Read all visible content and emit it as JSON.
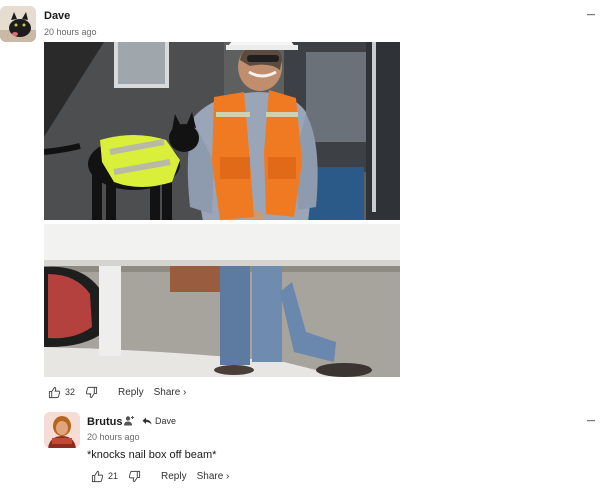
{
  "comments": [
    {
      "author": "Dave",
      "time": "20 hours ago",
      "likes": "32",
      "reply_label": "Reply",
      "share_label": "Share ›"
    },
    {
      "author": "Brutus",
      "reply_to": "Dave",
      "time": "20 hours ago",
      "text": "*knocks nail box off beam*",
      "likes": "21",
      "reply_label": "Reply",
      "share_label": "Share ›"
    }
  ],
  "icons": {
    "more": "more-options-icon",
    "like": "thumbs-up-icon",
    "dislike": "thumbs-down-icon",
    "user_badge": "user-plus-icon",
    "reply_arrow": "reply-arrow-icon"
  },
  "colors": {
    "vest_orange": "#f07a22",
    "vest_yellow": "#d9ef3a",
    "text_muted": "#6b6b6b"
  }
}
